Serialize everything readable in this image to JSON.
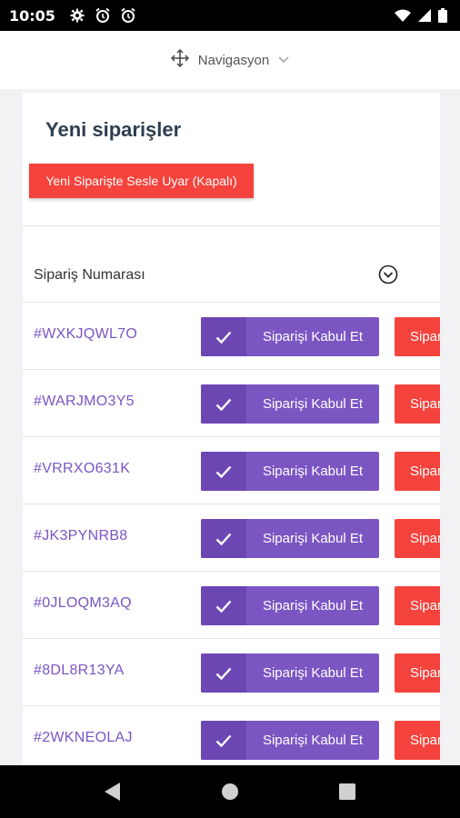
{
  "status_bar": {
    "time": "10:05",
    "icons": [
      "gear-icon",
      "alarm-icon",
      "alarm-icon",
      "wifi-icon",
      "signal-icon",
      "battery-icon"
    ]
  },
  "top_nav": {
    "icon": "move-icon",
    "label": "Navigasyon"
  },
  "card": {
    "title": "Yeni siparişler",
    "sound_alert_button": "Yeni Siparişte Sesle Uyar (Kapalı)",
    "table": {
      "column_header": "Sipariş Numarası",
      "rows": [
        {
          "order_id": "#WXKJQWL7O",
          "accept_label": "Siparişi Kabul Et",
          "reject_label": "Sipariş"
        },
        {
          "order_id": "#WARJMO3Y5",
          "accept_label": "Siparişi Kabul Et",
          "reject_label": "Sipariş"
        },
        {
          "order_id": "#VRRXO631K",
          "accept_label": "Siparişi Kabul Et",
          "reject_label": "Sipariş"
        },
        {
          "order_id": "#JK3PYNRB8",
          "accept_label": "Siparişi Kabul Et",
          "reject_label": "Sipariş"
        },
        {
          "order_id": "#0JLOQM3AQ",
          "accept_label": "Siparişi Kabul Et",
          "reject_label": "Sipariş"
        },
        {
          "order_id": "#8DL8R13YA",
          "accept_label": "Siparişi Kabul Et",
          "reject_label": "Sipariş"
        },
        {
          "order_id": "#2WKNEOLAJ",
          "accept_label": "Siparişi Kabul Et",
          "reject_label": "Sipariş"
        }
      ]
    }
  },
  "colors": {
    "accent_purple": "#7b56c3",
    "danger_red": "#f4433c",
    "title_text": "#2e3e50"
  }
}
